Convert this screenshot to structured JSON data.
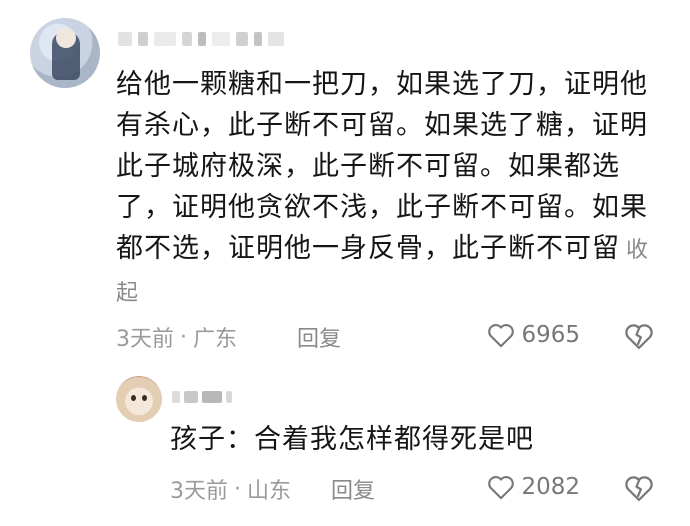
{
  "comment": {
    "text": "给他一颗糖和一把刀，如果选了刀，证明他有杀心，此子断不可留。如果选了糖，证明此子城府极深，此子断不可留。如果都选了，证明他贪欲不浅，此子断不可留。如果都不选，证明他一身反骨，此子断不可留",
    "collapse_label": "收起",
    "time": "3天前",
    "separator": "·",
    "location": "广东",
    "reply_label": "回复",
    "like_count": "6965",
    "icons": {
      "like": "heart-outline-icon",
      "dislike": "dislike-heart-icon"
    }
  },
  "reply": {
    "text": "孩子：合着我怎样都得死是吧",
    "time": "3天前",
    "separator": "·",
    "location": "山东",
    "reply_label": "回复",
    "like_count": "2082"
  },
  "colors": {
    "text": "#161616",
    "meta": "#9a9a9a",
    "icon": "#777777"
  }
}
